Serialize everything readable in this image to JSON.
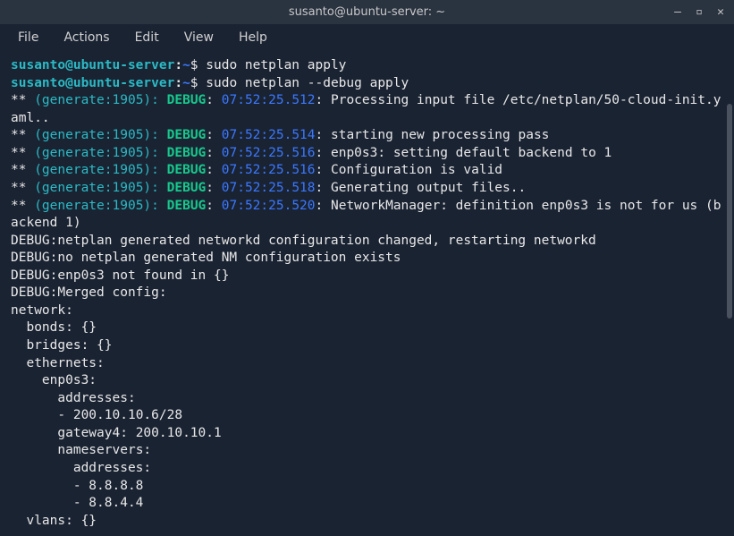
{
  "titlebar": {
    "title": "susanto@ubuntu-server: ~"
  },
  "window_controls": {
    "minimize": "—",
    "maximize": "▫",
    "close": "✕"
  },
  "menubar": {
    "items": [
      "File",
      "Actions",
      "Edit",
      "View",
      "Help"
    ]
  },
  "prompt": {
    "user_host": "susanto@ubuntu-server",
    "path": "~",
    "symbol": "$"
  },
  "commands": [
    "sudo netplan apply",
    "sudo netplan --debug apply"
  ],
  "debug_lines": [
    {
      "gen": "(generate:1905):",
      "ts": "07:52:25.512",
      "msg": "Processing input file /etc/netplan/50-cloud-init.yaml.."
    },
    {
      "gen": "(generate:1905):",
      "ts": "07:52:25.514",
      "msg": "starting new processing pass"
    },
    {
      "gen": "(generate:1905):",
      "ts": "07:52:25.516",
      "msg": "enp0s3: setting default backend to 1"
    },
    {
      "gen": "(generate:1905):",
      "ts": "07:52:25.516",
      "msg": "Configuration is valid"
    },
    {
      "gen": "(generate:1905):",
      "ts": "07:52:25.518",
      "msg": "Generating output files.."
    },
    {
      "gen": "(generate:1905):",
      "ts": "07:52:25.520",
      "msg": "NetworkManager: definition enp0s3 is not for us (backend 1)"
    }
  ],
  "plain_lines": [
    "DEBUG:netplan generated networkd configuration changed, restarting networkd",
    "DEBUG:no netplan generated NM configuration exists",
    "DEBUG:enp0s3 not found in {}",
    "DEBUG:Merged config:",
    "network:",
    "  bonds: {}",
    "  bridges: {}",
    "  ethernets:",
    "    enp0s3:",
    "      addresses:",
    "      - 200.10.10.6/28",
    "      gateway4: 200.10.10.1",
    "      nameservers:",
    "        addresses:",
    "        - 8.8.8.8",
    "        - 8.8.4.4",
    "  vlans: {}"
  ],
  "debug_label": "DEBUG",
  "stars": "**"
}
